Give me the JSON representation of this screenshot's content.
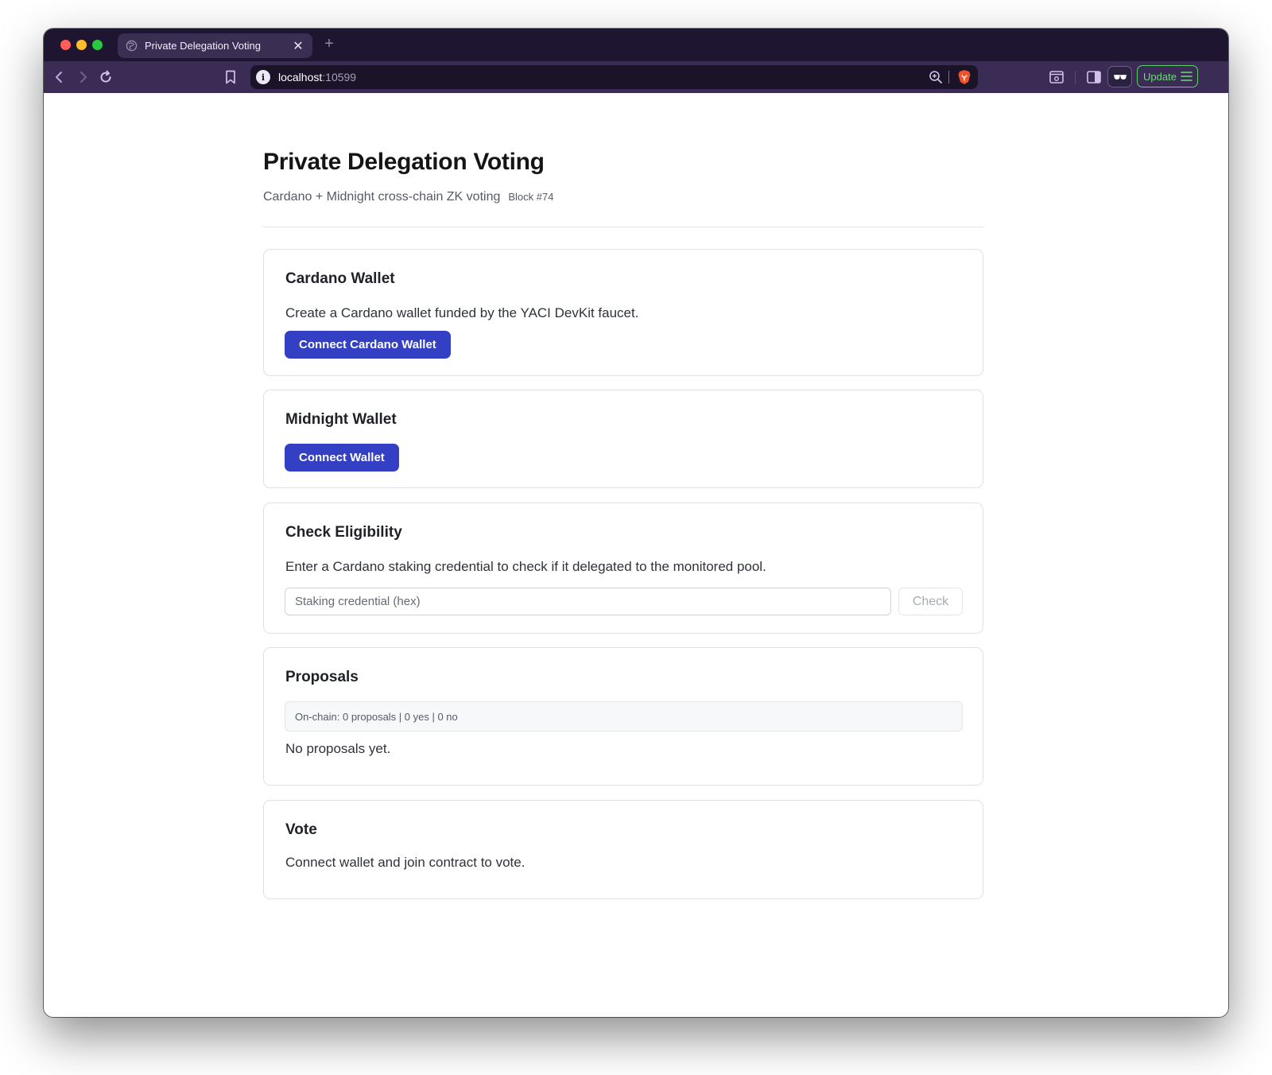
{
  "browser": {
    "tab_title": "Private Delegation Voting",
    "tab_close": "✕",
    "new_tab": "+",
    "url_host": "localhost",
    "url_port": ":10599",
    "info_glyph": "i",
    "update_label": "Update",
    "colors": {
      "frame": "#1e1630",
      "toolbar": "#3a2c55",
      "update": "#5fcf6d"
    }
  },
  "header": {
    "title": "Private Delegation Voting",
    "subtitle": "Cardano + Midnight cross-chain ZK voting",
    "block": "Block #74"
  },
  "cardano_wallet": {
    "title": "Cardano Wallet",
    "description": "Create a Cardano wallet funded by the YACI DevKit faucet.",
    "button": "Connect Cardano Wallet"
  },
  "midnight_wallet": {
    "title": "Midnight Wallet",
    "button": "Connect Wallet"
  },
  "eligibility": {
    "title": "Check Eligibility",
    "description": "Enter a Cardano staking credential to check if it delegated to the monitored pool.",
    "input_placeholder": "Staking credential (hex)",
    "input_value": "",
    "button": "Check"
  },
  "proposals": {
    "title": "Proposals",
    "onchain_summary": "On-chain: 0 proposals | 0 yes | 0 no",
    "empty_text": "No proposals yet."
  },
  "vote": {
    "title": "Vote",
    "description": "Connect wallet and join contract to vote."
  },
  "theme": {
    "primary_button": "#3440c3"
  }
}
